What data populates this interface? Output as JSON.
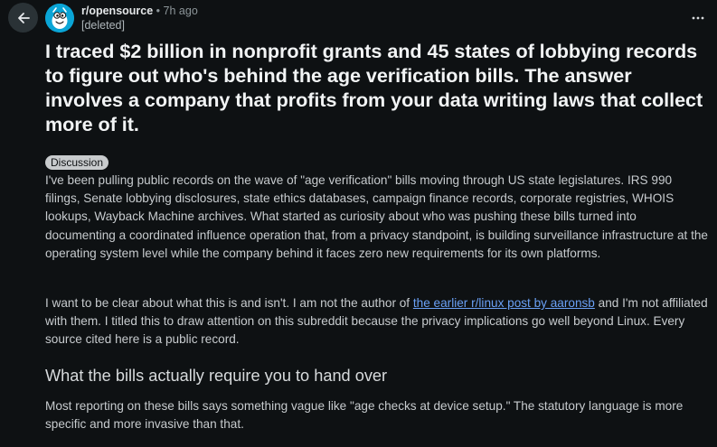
{
  "post": {
    "subreddit": "r/opensource",
    "separator": "•",
    "time_ago": "7h ago",
    "author": "[deleted]",
    "title": "I traced $2 billion in nonprofit grants and 45 states of lobbying records to figure out who's behind the age verification bills. The answer involves a company that profits from your data writing laws that collect more of it.",
    "flair": "Discussion",
    "paragraph_1": "I've been pulling public records on the wave of \"age verification\" bills moving through US state legislatures. IRS 990 filings, Senate lobbying disclosures, state ethics databases, campaign finance records, corporate registries, WHOIS lookups, Wayback Machine archives. What started as curiosity about who was pushing these bills turned into documenting a coordinated influence operation that, from a privacy standpoint, is building surveillance infrastructure at the operating system level while the company behind it faces zero new requirements for its own platforms.",
    "paragraph_2_before_link": "I want to be clear about what this is and isn't. I am not the author of ",
    "paragraph_2_link": "the earlier r/linux post by aaronsb",
    "paragraph_2_after_link": " and I'm not affiliated with them. I titled this to draw attention on this subreddit because the privacy implications go well beyond Linux. Every source cited here is a public record.",
    "section_heading": "What the bills actually require you to hand over",
    "paragraph_3": "Most reporting on these bills says something vague like \"age checks at device setup.\" The statutory language is more specific and more invasive than that."
  },
  "icons": {
    "back": "arrow-left-icon",
    "avatar": "subreddit-avatar",
    "overflow": "more-horizontal-icon"
  },
  "colors": {
    "background": "#0e1113",
    "link": "#6aa0f5",
    "flair_bg": "#c8cbcd",
    "avatar_bg": "#0aa5d6"
  }
}
